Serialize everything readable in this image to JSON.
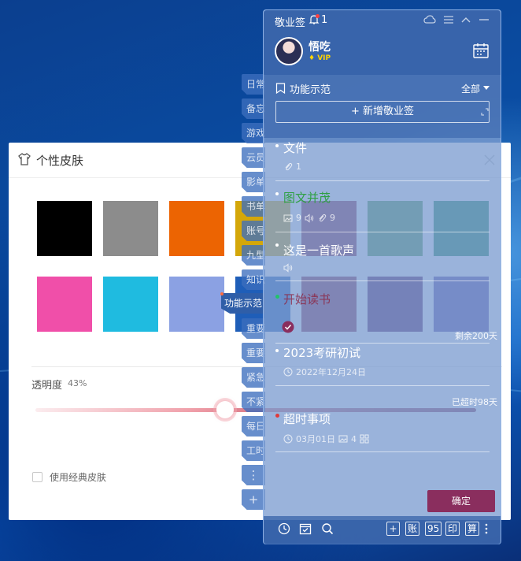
{
  "skin_dialog": {
    "title": "个性皮肤",
    "swatches": [
      "#000000",
      "#8c8c8c",
      "#ec6402",
      "#d4a70a",
      "#8b2f54",
      "#4f9a51",
      "#1d8a5b",
      "#f04fa9",
      "#1fbbe0",
      "#8ba1e3",
      "#1f5eb8",
      "#8b2f54",
      "#562366",
      "#5b4fa9"
    ],
    "opacity_label": "透明度",
    "opacity_value": "43%",
    "opacity_fraction": 0.43,
    "classic_skin_label": "使用经典皮肤"
  },
  "side_tabs": [
    "日常",
    "备忘",
    "游戏",
    "云员",
    "影单",
    "书单",
    "账号",
    "九型",
    "知识",
    "重要",
    "重要",
    "紧急",
    "不紧",
    "每日",
    "工时",
    "⋮",
    "+"
  ],
  "tooltip": "功能示范",
  "panel": {
    "app_name": "敬业签",
    "bell_count": "1",
    "username": "悟吃",
    "vip": "VIP",
    "category": "功能示范",
    "filter": "全部",
    "add_note": "+ 新增敬业签",
    "notes": [
      {
        "title": "文件",
        "meta": [
          "1"
        ]
      },
      {
        "title": "图文并茂",
        "meta": [
          "9",
          "9"
        ]
      },
      {
        "title": "这是一首歌声",
        "meta": []
      },
      {
        "title": "开始读书",
        "meta": [],
        "right": "剩余200天"
      },
      {
        "title": "2023考研初试",
        "meta": [
          "2022年12月24日"
        ]
      },
      {
        "title": "超时事项",
        "meta": [
          "03月01日",
          "4"
        ],
        "right": "已超时98天"
      }
    ],
    "confirm": "确定",
    "bottom_boxes": [
      "+",
      "账",
      "95",
      "印",
      "算"
    ]
  },
  "colors": {
    "panel_bg": "#7e9ed1",
    "accent_red": "#8a2e5e",
    "green_title": "#2ea043"
  }
}
